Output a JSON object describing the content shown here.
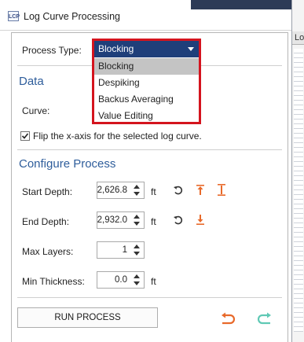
{
  "window": {
    "title": "Log Curve Processing",
    "icon_text": "LCP"
  },
  "side_panel": {
    "header": "Lo"
  },
  "process_type": {
    "label": "Process Type:",
    "selected": "Blocking",
    "options": [
      "Blocking",
      "Despiking",
      "Backus Averaging",
      "Value Editing"
    ],
    "highlighted_option": "Blocking"
  },
  "data_section": {
    "title": "Data",
    "curve_label": "Curve:",
    "flip_checkbox": {
      "label": "Flip the x-axis for the selected log curve.",
      "checked": true
    }
  },
  "configure": {
    "title": "Configure Process",
    "start_depth": {
      "label": "Start Depth:",
      "value": "2,626.8",
      "unit": "ft"
    },
    "end_depth": {
      "label": "End Depth:",
      "value": "2,932.0",
      "unit": "ft"
    },
    "max_layers": {
      "label": "Max Layers:",
      "value": "1"
    },
    "min_thickness": {
      "label": "Min Thickness:",
      "value": "0.0",
      "unit": "ft"
    }
  },
  "actions": {
    "run_label": "RUN PROCESS",
    "undo_icon": "undo-icon",
    "redo_icon": "redo-icon"
  },
  "colors": {
    "accent_blue": "#2e5d9b",
    "selected_bg": "#1f3f7a",
    "highlight_red": "#d4141e",
    "orange_icon": "#e8692a",
    "teal_icon": "#5fc9b5"
  }
}
